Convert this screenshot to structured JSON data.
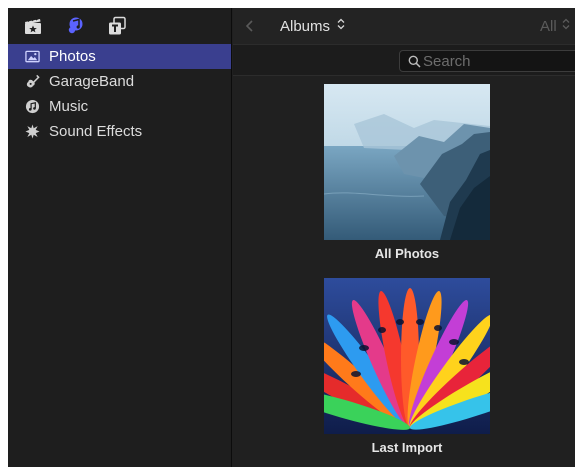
{
  "toolbar": {
    "icons": [
      "photos-and-video-icon",
      "music-and-sound-icon",
      "titles-and-generators-icon"
    ]
  },
  "sidebar": {
    "items": [
      {
        "label": "Photos",
        "icon": "photos-icon",
        "selected": true
      },
      {
        "label": "GarageBand",
        "icon": "guitar-icon",
        "selected": false
      },
      {
        "label": "Music",
        "icon": "music-icon",
        "selected": false
      },
      {
        "label": "Sound Effects",
        "icon": "burst-icon",
        "selected": false
      }
    ]
  },
  "browser": {
    "album_popup_label": "Albums",
    "filter_label": "All",
    "search_placeholder": "Search",
    "search_value": ""
  },
  "albums": [
    {
      "label": "All Photos",
      "thumb": "coastal-cliffs"
    },
    {
      "label": "Last Import",
      "thumb": "colorful-kayaks"
    }
  ],
  "colors": {
    "selection": "#3a3f8f",
    "accent_icon": "#5b63ff"
  }
}
